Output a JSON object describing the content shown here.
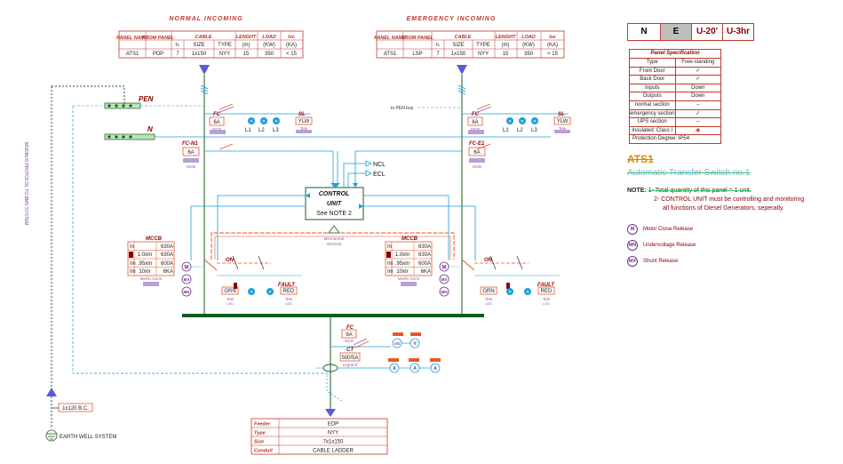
{
  "incoming": {
    "normal_title": "NORMAL INCOMING",
    "emergency_title": "EMERGENCY INCOMING",
    "headers": [
      "PANEL NAME",
      "FROM PANEL",
      "CABLE",
      "LENGHT",
      "LOAD",
      "Isc"
    ],
    "subheaders": [
      "n.",
      "SIZE",
      "TYPE",
      "(m)",
      "(KW)",
      "(KA)"
    ],
    "normal_row": [
      "ATS1",
      "PDP",
      "7",
      "1x150",
      "NYY",
      "15",
      "350",
      "< 15"
    ],
    "emergency_row": [
      "ATS1",
      "LSP",
      "7",
      "1x150",
      "NYY",
      "15",
      "350",
      "< 15"
    ]
  },
  "labels": {
    "pen": "PEN",
    "n": "N",
    "to_pen_bus": "to PEN bus",
    "modbus": "MODBUS PROTOCOL TO BMS SYSTEM",
    "control_unit": [
      "CONTROL",
      "UNIT",
      "See NOTE 2"
    ],
    "ncl": "NCL",
    "ecl": "ECL",
    "mech_interlock": [
      "Mechanical",
      "Interlock"
    ],
    "earth_well": "EARTH WELL SYSTEM",
    "bc": "1x120 B.C."
  },
  "fc_left": {
    "name": "FC",
    "rating": "6A",
    "sub": "MCB"
  },
  "fc_right": {
    "name": "FC",
    "rating": "6A",
    "sub": "MCB"
  },
  "fcn1": {
    "name": "FC-N1",
    "rating": "6A",
    "sub": "MCB"
  },
  "fce1": {
    "name": "FC-E1",
    "rating": "6A",
    "sub": "MCB"
  },
  "fc_bottom": {
    "name": "FC",
    "rating": "6A",
    "sub": "MCB"
  },
  "sl": {
    "name": "SL",
    "value": "YLW",
    "sub": "Tele"
  },
  "lamps": [
    "L1",
    "L2",
    "L3"
  ],
  "mccb": {
    "title": "MCCB",
    "rows": [
      [
        "In",
        "630A"
      ],
      [
        "Ir",
        "1.0xIn",
        "630A"
      ],
      [
        "Im",
        ".95xIn",
        "600A"
      ],
      [
        "Im",
        "10xIr",
        "6KA"
      ]
    ],
    "brand": "Merlin Gerin"
  },
  "breaker_symbols": [
    "M",
    "MX",
    "MN"
  ],
  "on_lamp": {
    "name": "ON",
    "value": "GRN",
    "sub": [
      "Tele",
      "LED"
    ]
  },
  "fault_lamp": {
    "name": "FAULT",
    "value": "RED",
    "sub": [
      "Tele",
      "LED"
    ]
  },
  "ct": {
    "name": "CT",
    "ratio": "500/5A",
    "sub": "Legrand"
  },
  "meters": [
    "VS",
    "V",
    "A",
    "A",
    "A"
  ],
  "outgoing": {
    "rows": [
      [
        "Feeder",
        "EDP"
      ],
      [
        "Type",
        "NYY"
      ],
      [
        "Size",
        "7x1x150"
      ],
      [
        "Conduit",
        "CABLE LADDER"
      ]
    ]
  },
  "legend": {
    "boxes": [
      "N",
      "E",
      "U-20'",
      "U-3hr"
    ],
    "highlight": "#bfbfbf"
  },
  "panel_spec": {
    "title": "Panel Specification",
    "rows": [
      [
        "Type",
        "Free-standing"
      ],
      [
        "Front Door",
        "✓"
      ],
      [
        "Back Door",
        "✓"
      ],
      [
        "Inputs",
        "Down"
      ],
      [
        "Outputs",
        "Down"
      ],
      [
        "normal section",
        "–"
      ],
      [
        "emergency section",
        "✓"
      ],
      [
        "UPS section",
        "–"
      ],
      [
        "Insulated: Class I",
        "◉"
      ],
      [
        "Protection Degree: IP54",
        ""
      ]
    ]
  },
  "ats": {
    "title": "ATS1",
    "subtitle": "Automatic Transfer Switch no.1",
    "note_key": "NOTE:",
    "note1": "1- Total quantity of this panel = 1 unit.",
    "note2": "2- CONTROL UNIT must be controlling and monitoring",
    "note2b": "all functions of Diesel Generators, seperatly."
  },
  "symbol_legend": [
    {
      "sym": "M",
      "text": "Motor Close Release"
    },
    {
      "sym": "MN",
      "text": "Undervoltage Release"
    },
    {
      "sym": "MX",
      "text": "Shunt Release"
    }
  ],
  "colors": {
    "busbar": "#0b5d1e",
    "wire": "#1a9fd6",
    "orange": "#e8572a",
    "purple": "#9b59b6",
    "dark_green": "#1e5a1e",
    "red_text": "#c0392b"
  }
}
